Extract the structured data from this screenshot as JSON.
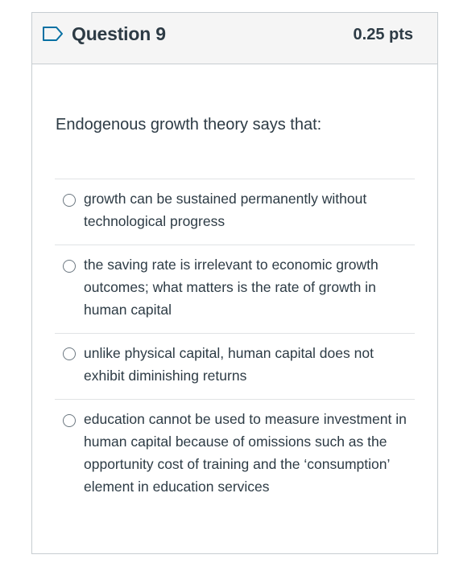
{
  "header": {
    "title": "Question 9",
    "points": "0.25 pts",
    "icon": "flag-icon"
  },
  "question": {
    "text": "Endogenous growth theory says that:"
  },
  "answers": [
    {
      "label": "growth can be sustained permanently without technological progress",
      "selected": false
    },
    {
      "label": "the saving rate is irrelevant to economic growth outcomes; what matters is the rate of growth in human capital",
      "selected": false
    },
    {
      "label": "unlike physical capital, human capital does not exhibit diminishing returns",
      "selected": false
    },
    {
      "label": "education cannot be used to measure investment in human capital because of omissions such as the opportunity cost of training and the ‘consumption’ element in education services",
      "selected": false
    }
  ],
  "colors": {
    "text": "#2d3b45",
    "border": "#c7cdd1",
    "header_bg": "#f5f5f5",
    "divider": "#e0e3e5",
    "flag": "#0770a3"
  }
}
